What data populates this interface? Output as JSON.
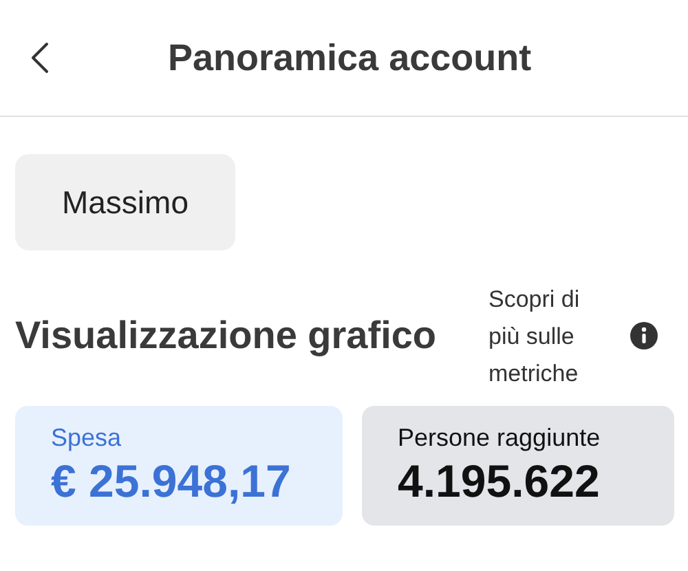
{
  "header": {
    "title": "Panoramica account"
  },
  "account_chip": "Massimo",
  "section": {
    "title": "Visualizzazione grafico",
    "link": "Scopri di più sulle metriche"
  },
  "metrics": [
    {
      "label": "Spesa",
      "value": "€ 25.948,17",
      "selected": true
    },
    {
      "label": "Persone raggiunte",
      "value": "4.195.622",
      "selected": false
    }
  ]
}
